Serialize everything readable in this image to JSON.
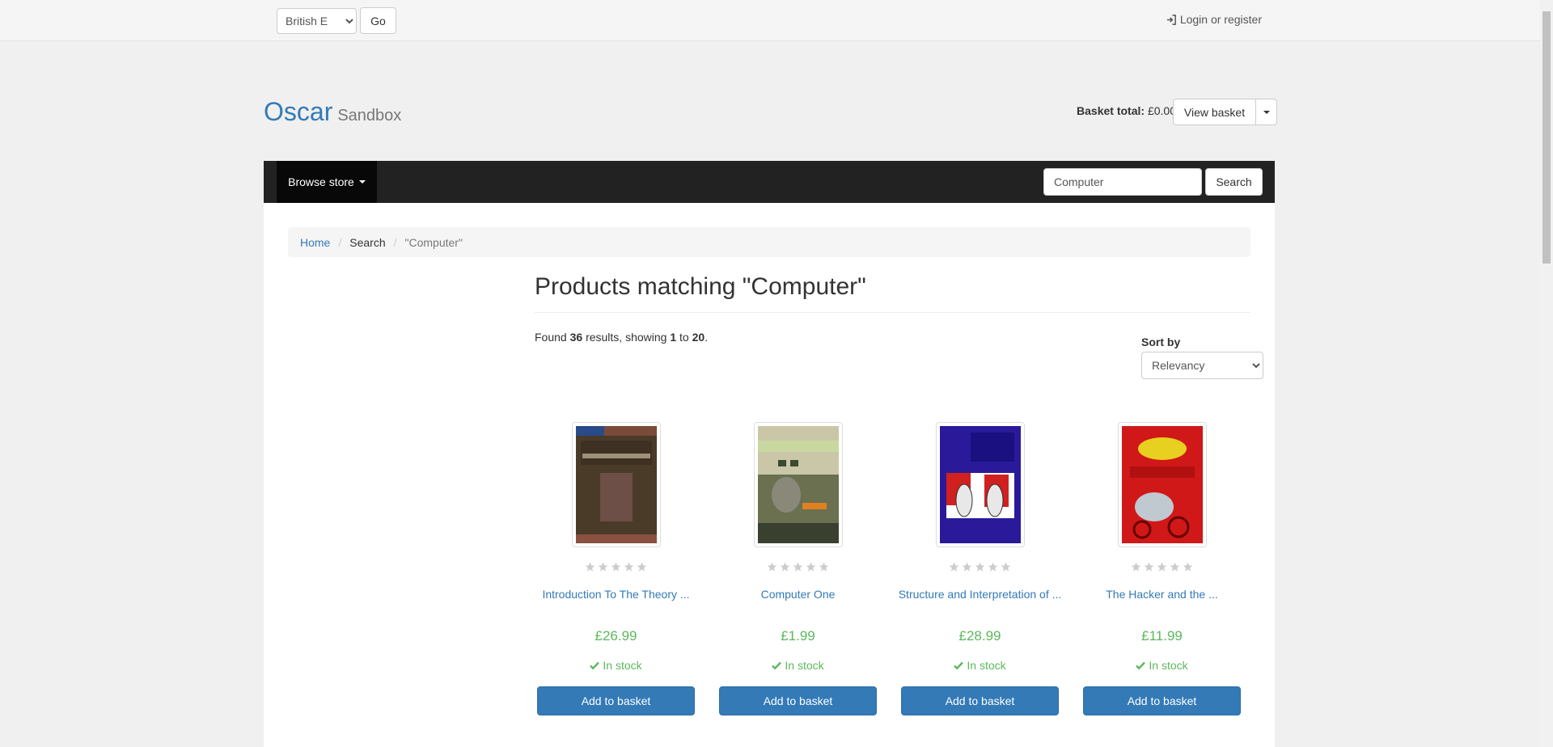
{
  "topbar": {
    "language_value": "British E",
    "go_label": "Go",
    "login_label": "Login or register"
  },
  "header": {
    "brand_name": "Oscar",
    "brand_sub": "Sandbox",
    "basket_total_label": "Basket total:",
    "basket_total_value": "£0.00",
    "view_basket_label": "View basket"
  },
  "navbar": {
    "browse_label": "Browse store",
    "search_value": "Computer",
    "search_button": "Search"
  },
  "breadcrumb": {
    "home": "Home",
    "search": "Search",
    "query": "\"Computer\""
  },
  "main": {
    "title": "Products matching \"Computer\"",
    "found_prefix": "Found",
    "found_count": "36",
    "results_mid": "results, showing",
    "range_start": "1",
    "range_to": "to",
    "range_end": "20",
    "period": ".",
    "sort_label": "Sort by",
    "sort_value": "Relevancy"
  },
  "products": [
    {
      "title": "Introduction To The Theory ...",
      "price": "£26.99",
      "stock": "In stock",
      "button": "Add to basket",
      "rating": 0
    },
    {
      "title": "Computer One",
      "price": "£1.99",
      "stock": "In stock",
      "button": "Add to basket",
      "rating": 0
    },
    {
      "title": "Structure and Interpretation of ...",
      "price": "£28.99",
      "stock": "In stock",
      "button": "Add to basket",
      "rating": 0
    },
    {
      "title": "The Hacker and the ...",
      "price": "£11.99",
      "stock": "In stock",
      "button": "Add to basket",
      "rating": 0
    }
  ],
  "colors": {
    "link": "#337ab7",
    "price": "#5cb85c",
    "navbar": "#222222",
    "button": "#337ab7"
  }
}
